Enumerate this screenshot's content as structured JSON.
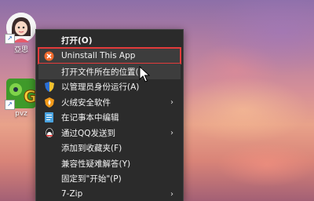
{
  "desktop": {
    "icons": [
      {
        "label": "亞思",
        "icon": "avatar-icon"
      },
      {
        "label": "pvz",
        "icon": "pvz-game-icon"
      }
    ]
  },
  "menu": {
    "items": [
      {
        "label": "打开(O)",
        "bold": true,
        "icon": ""
      },
      {
        "label": "Uninstall This App",
        "icon": "uninstall-icon",
        "highlighted": true
      },
      {
        "label": "打开文件所在的位置(I)",
        "icon": ""
      },
      {
        "label": "以管理员身份运行(A)",
        "icon": "shield-icon"
      },
      {
        "label": "火绒安全软件",
        "icon": "huorong-icon",
        "submenu": true
      },
      {
        "label": "在记事本中编辑",
        "icon": "notepad-icon"
      },
      {
        "label": "通过QQ发送到",
        "icon": "qq-icon",
        "submenu": true
      },
      {
        "label": "添加到收藏夹(F)",
        "icon": ""
      },
      {
        "label": "兼容性疑难解答(Y)",
        "icon": ""
      },
      {
        "label": "固定到\"开始\"(P)",
        "icon": ""
      },
      {
        "label": "7-Zip",
        "icon": "",
        "submenu": true
      }
    ]
  },
  "colors": {
    "highlight_box": "#e23b3b",
    "menu_bg": "#2b2b2b"
  }
}
